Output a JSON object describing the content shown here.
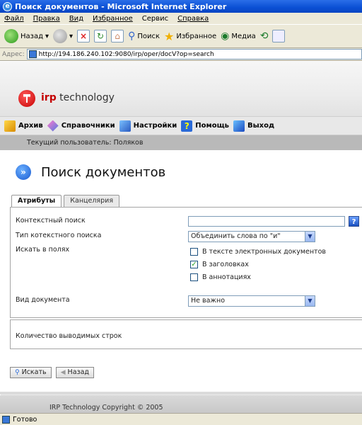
{
  "browser": {
    "title": "Поиск документов - Microsoft Internet Explorer",
    "menu": [
      "Файл",
      "Правка",
      "Вид",
      "Избранное",
      "Сервис",
      "Справка"
    ],
    "toolbar": {
      "back": "Назад",
      "search": "Поиск",
      "favorites": "Избранное",
      "media": "Медиа"
    },
    "address_label": "Адрес:",
    "address_url": "http://194.186.240.102:9080/irp/oper/docV?op=search",
    "status": "Готово"
  },
  "brand": {
    "logo_irp": "irp",
    "logo_rest": " technology"
  },
  "nav": [
    {
      "label": "Архив"
    },
    {
      "label": "Справочники"
    },
    {
      "label": "Настройки"
    },
    {
      "label": "Помощь"
    },
    {
      "label": "Выход"
    }
  ],
  "user_line": "Текущий пользователь: Поляков",
  "page_title": "Поиск документов",
  "tabs": [
    "Атрибуты",
    "Канцелярия"
  ],
  "form": {
    "context_search_label": "Контекстный поиск",
    "context_search_value": "",
    "search_type_label": "Тип котекстного поиска",
    "search_type_value": "Объединить слова по \"и\"",
    "search_fields_label": "Искать в полях",
    "checkboxes": [
      {
        "label": "В тексте электронных документов",
        "checked": false
      },
      {
        "label": "В заголовках",
        "checked": true
      },
      {
        "label": "В аннотациях",
        "checked": false
      }
    ],
    "doc_type_label": "Вид документа",
    "doc_type_value": "Не важно",
    "rows_label": "Количество выводимых строк",
    "help_glyph": "?"
  },
  "buttons": {
    "search": "Искать",
    "back": "Назад"
  },
  "footer": "IRP Technology Copyright © 2005"
}
